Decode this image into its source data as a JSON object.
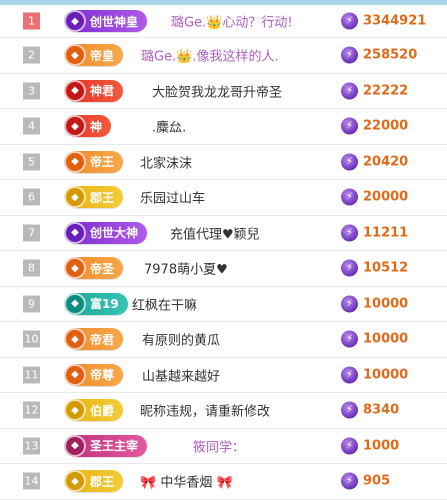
{
  "colors": {
    "rank_top": "#ee6f6f",
    "rank_default": "#b9b9b9",
    "value": "#e06a1a",
    "coin": "#7b3fc8",
    "divider": "#a8d4ec"
  },
  "rows": [
    {
      "rank": "1",
      "badge": "创世神皇",
      "badge_style": "purple",
      "name": "璐Ge.👑心动？行动!",
      "name_style": "purple",
      "value": "3344921"
    },
    {
      "rank": "2",
      "badge": "帝皇",
      "badge_style": "orange",
      "name": "璐Ge.👑.像我这样的人.",
      "name_style": "purple",
      "value": "258520"
    },
    {
      "rank": "3",
      "badge": "神君",
      "badge_style": "red",
      "name": "大脸贺我龙龙哥升帝圣",
      "name_style": "normal",
      "value": "22222"
    },
    {
      "rank": "4",
      "badge": "神",
      "badge_style": "red",
      "name": ".麋厽.",
      "name_style": "normal",
      "value": "22000"
    },
    {
      "rank": "5",
      "badge": "帝王",
      "badge_style": "orange",
      "name": "北家沫沫",
      "name_style": "normal",
      "value": "20420"
    },
    {
      "rank": "6",
      "badge": "郡王",
      "badge_style": "gold",
      "name": "乐园过山车",
      "name_style": "normal",
      "value": "20000"
    },
    {
      "rank": "7",
      "badge": "创世大神",
      "badge_style": "purple",
      "name": "充值代理♥颖兒",
      "name_style": "normal",
      "value": "11211"
    },
    {
      "rank": "8",
      "badge": "帝圣",
      "badge_style": "orange",
      "name": "7978萌小夏♥",
      "name_style": "normal",
      "value": "10512"
    },
    {
      "rank": "9",
      "badge": "富19",
      "badge_style": "teal",
      "name": "红枫在干嘛",
      "name_style": "normal",
      "value": "10000"
    },
    {
      "rank": "10",
      "badge": "帝君",
      "badge_style": "orange",
      "name": "有原则的黄瓜",
      "name_style": "normal",
      "value": "10000"
    },
    {
      "rank": "11",
      "badge": "帝尊",
      "badge_style": "orange",
      "name": "山基越来越好",
      "name_style": "normal",
      "value": "10000"
    },
    {
      "rank": "12",
      "badge": "伯爵",
      "badge_style": "gold",
      "name": "昵称违规，请重新修改",
      "name_style": "normal",
      "value": "8340"
    },
    {
      "rank": "13",
      "badge": "圣王主宰",
      "badge_style": "pink",
      "name": "筱同学：",
      "name_style": "purple",
      "value": "1000"
    },
    {
      "rank": "14",
      "badge": "郡王",
      "badge_style": "gold",
      "name": "🎀 中华香烟 🎀",
      "name_style": "normal",
      "value": "905"
    }
  ],
  "icons": {
    "coin": "lightning-coin-icon",
    "emblem": "rank-emblem-icon"
  }
}
